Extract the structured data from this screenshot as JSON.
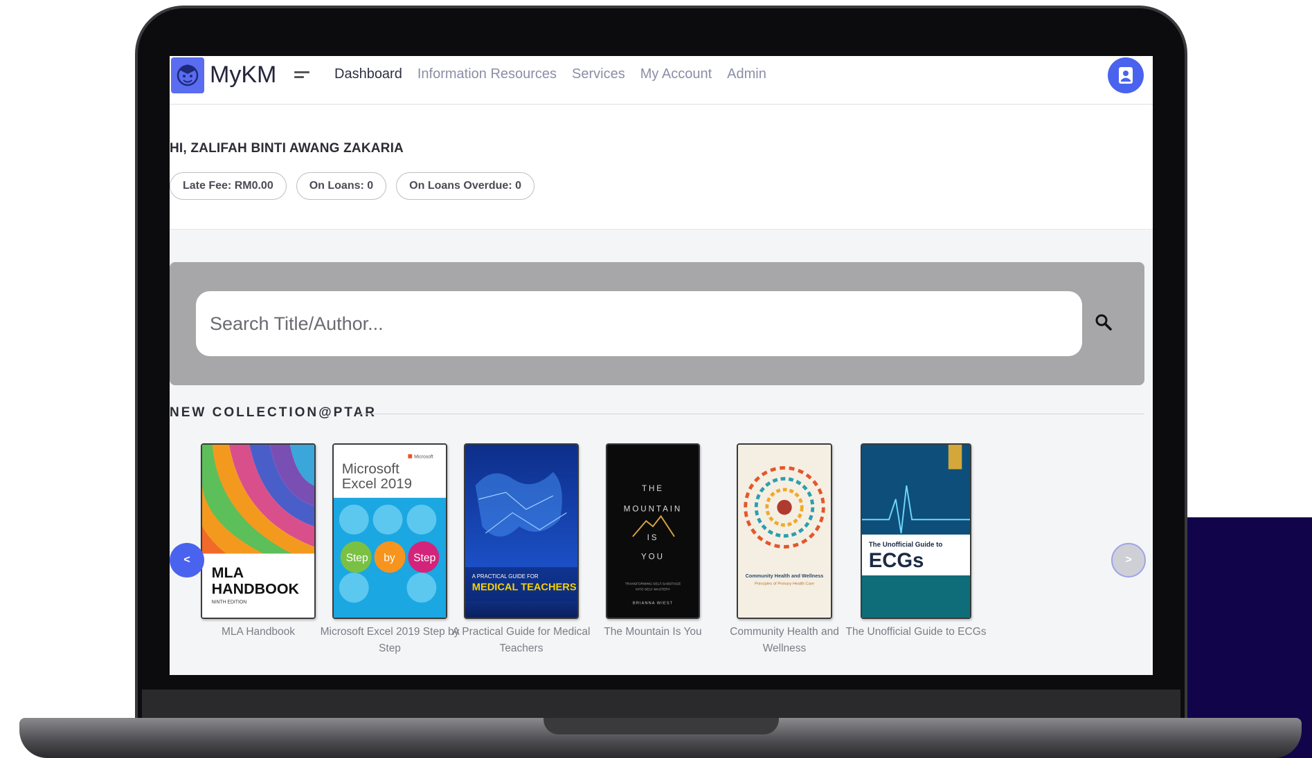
{
  "header": {
    "brand": "MyKM",
    "nav": [
      "Dashboard",
      "Information Resources",
      "Services",
      "My Account",
      "Admin"
    ],
    "active_nav": "Dashboard",
    "colors": {
      "accent": "#4a63ee",
      "logo": "#5a6cf0"
    }
  },
  "greeting": {
    "text": "HI, ZALIFAH BINTI AWANG ZAKARIA",
    "badges": [
      "Late Fee: RM0.00",
      "On Loans: 0",
      "On Loans Overdue: 0"
    ]
  },
  "search": {
    "placeholder": "Search Title/Author...",
    "icon": "search-icon"
  },
  "section": {
    "title": "NEW COLLECTION@PTAR"
  },
  "books": [
    {
      "title": "MLA Handbook",
      "cover_lines": [
        "MLA",
        "HANDBOOK",
        "NINTH EDITION"
      ]
    },
    {
      "title": "Microsoft Excel 2019 Step by Step",
      "cover_lines": [
        "Microsoft",
        "Excel 2019",
        "Step",
        "by",
        "Step",
        "Microsoft"
      ]
    },
    {
      "title": "A Practical Guide for Medical Teachers",
      "cover_lines": [
        "A PRACTICAL GUIDE FOR",
        "MEDICAL TEACHERS"
      ]
    },
    {
      "title": "The Mountain Is You",
      "cover_lines": [
        "THE",
        "MOUNTAIN",
        "IS",
        "YOU",
        "TRANSFORMING SELF-SABOTAGE",
        "INTO SELF-MASTERY",
        "BRIANNA WIEST"
      ]
    },
    {
      "title": "Community Health and Wellness",
      "cover_lines": [
        "Community Health and Wellness",
        "Principles of Primary Health Care"
      ]
    },
    {
      "title": "The Unofficial Guide to ECGs",
      "cover_lines": [
        "The Unofficial Guide to",
        "ECGs"
      ]
    }
  ],
  "carousel": {
    "prev_label": "<",
    "next_label": ">"
  }
}
